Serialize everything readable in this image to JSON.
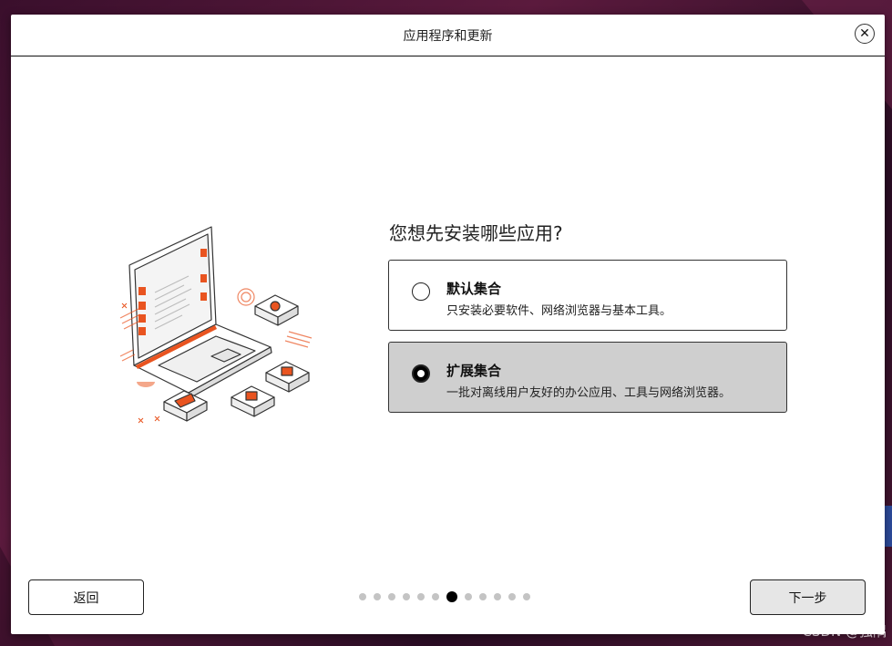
{
  "window": {
    "title": "应用程序和更新"
  },
  "question": "您想先安装哪些应用?",
  "options": [
    {
      "title": "默认集合",
      "desc": "只安装必要软件、网络浏览器与基本工具。",
      "selected": false
    },
    {
      "title": "扩展集合",
      "desc": "一批对离线用户友好的办公应用、工具与网络浏览器。",
      "selected": true
    }
  ],
  "buttons": {
    "back": "返回",
    "next": "下一步"
  },
  "progress": {
    "total": 12,
    "current": 7
  },
  "icons": {
    "close": "close-icon",
    "radio_unselected": "radio-empty-icon",
    "radio_selected": "radio-filled-icon"
  },
  "colors": {
    "accent": "#E95420",
    "selected_bg": "#cfcfcf"
  },
  "watermark": "CSDN @独隅"
}
